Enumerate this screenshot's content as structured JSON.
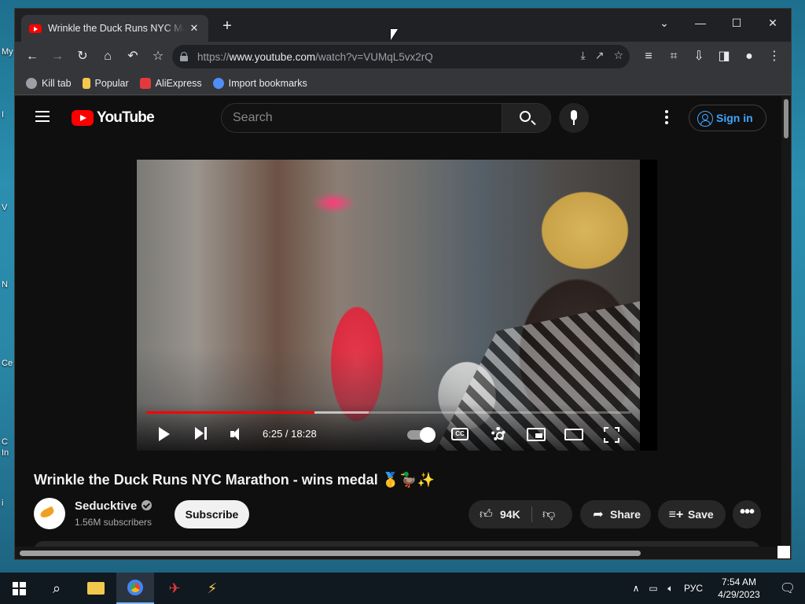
{
  "desktop": {
    "labels": [
      "My",
      "I",
      "V",
      "N",
      "Ce",
      "C",
      "In",
      "i"
    ]
  },
  "browser": {
    "tab_title": "Wrinkle the Duck Runs NYC Marathon - wins medal",
    "new_tab": "+",
    "url_prefix": "https://",
    "url_host": "www.youtube.com",
    "url_path": "/watch?v=VUMqL5vx2rQ",
    "bookmarks": [
      {
        "label": "Kill tab",
        "color": "#9aa0a6"
      },
      {
        "label": "Popular",
        "color": "#f2c94c"
      },
      {
        "label": "AliExpress",
        "color": "#e4393c"
      },
      {
        "label": "Import bookmarks",
        "color": "#4f8ef7"
      }
    ]
  },
  "youtube": {
    "logo_text": "YouTube",
    "search_placeholder": "Search",
    "signin_label": "Sign in",
    "accent": "#3ea6ff",
    "player": {
      "time_label": "6:25 / 18:28",
      "played_fraction": 0.348,
      "buffered_fraction": 0.46,
      "cc_label": "CC"
    },
    "video_title": "Wrinkle the Duck Runs NYC Marathon - wins medal 🥇🦆✨",
    "channel_name": "Seducktive",
    "subscribers": "1.56M subscribers",
    "subscribe_label": "Subscribe",
    "likes": "94K",
    "share_label": "Share",
    "save_label": "Save",
    "more_label": "•••"
  },
  "taskbar": {
    "language": "РУС",
    "time": "7:54 AM",
    "date": "4/29/2023"
  }
}
